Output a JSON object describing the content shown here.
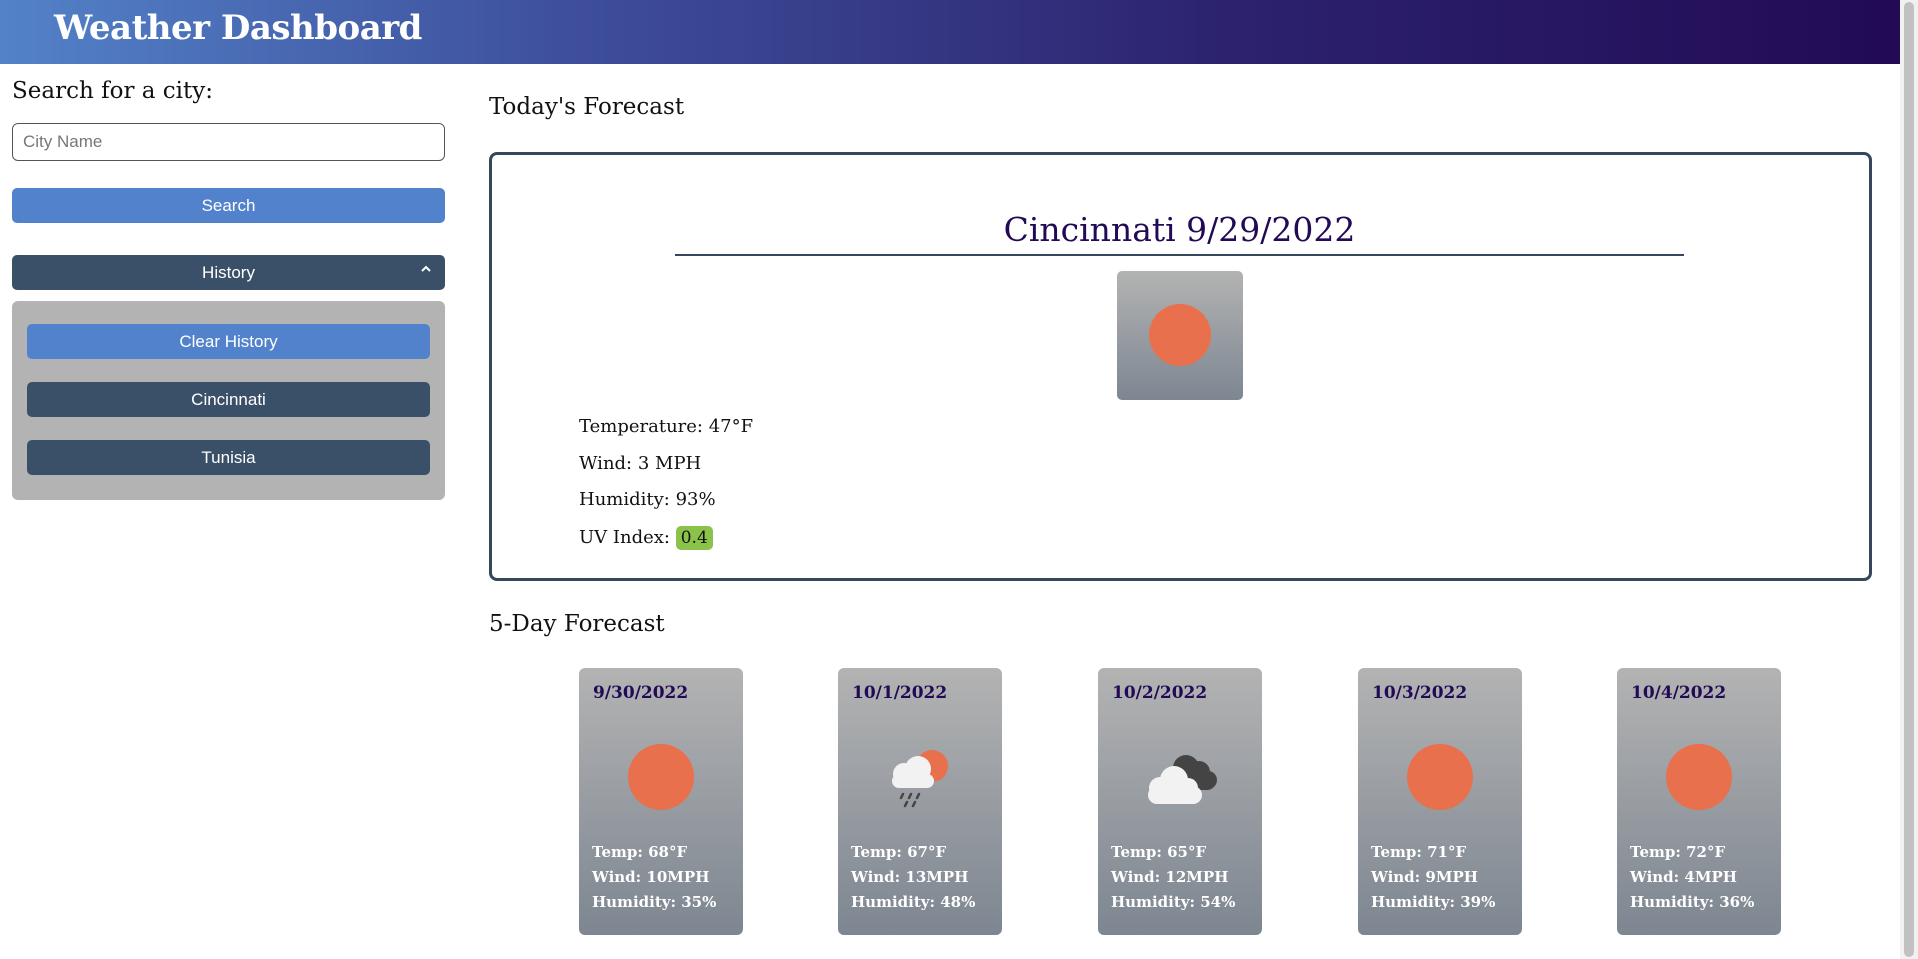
{
  "header": {
    "title": "Weather Dashboard"
  },
  "sidebar": {
    "search_title": "Search for a city:",
    "search_placeholder": "City Name",
    "search_value": "",
    "search_button": "Search",
    "history_button": "History",
    "history_icon": "chevron-up-icon",
    "clear_history_button": "Clear History",
    "history_items": [
      "Cincinnati",
      "Tunisia"
    ]
  },
  "today": {
    "section_title": "Today's Forecast",
    "city_date": "Cincinnati 9/29/2022",
    "icon": "sun-icon",
    "temperature": "Temperature: 47°F",
    "wind": "Wind: 3 MPH",
    "humidity": "Humidity: 93%",
    "uv_label": "UV Index:",
    "uv_value": "0.4",
    "uv_color": "#8bc34a"
  },
  "forecast": {
    "section_title": "5-Day Forecast",
    "days": [
      {
        "date": "9/30/2022",
        "icon": "sun-icon",
        "temp": "Temp: 68°F",
        "wind": "Wind: 10MPH",
        "humidity": "Humidity: 35%"
      },
      {
        "date": "10/1/2022",
        "icon": "sun-rain-cloud-icon",
        "temp": "Temp: 67°F",
        "wind": "Wind: 13MPH",
        "humidity": "Humidity: 48%"
      },
      {
        "date": "10/2/2022",
        "icon": "cloudy-icon",
        "temp": "Temp: 65°F",
        "wind": "Wind: 12MPH",
        "humidity": "Humidity: 54%"
      },
      {
        "date": "10/3/2022",
        "icon": "sun-icon",
        "temp": "Temp: 71°F",
        "wind": "Wind: 9MPH",
        "humidity": "Humidity: 39%"
      },
      {
        "date": "10/4/2022",
        "icon": "sun-icon",
        "temp": "Temp: 72°F",
        "wind": "Wind: 4MPH",
        "humidity": "Humidity: 36%"
      }
    ]
  },
  "colors": {
    "header_start": "#5382c8",
    "header_end": "#220a55",
    "primary_button": "#5382cc",
    "dark_button": "#3a5069",
    "sun": "#e8704c",
    "accent_text": "#220a55"
  }
}
